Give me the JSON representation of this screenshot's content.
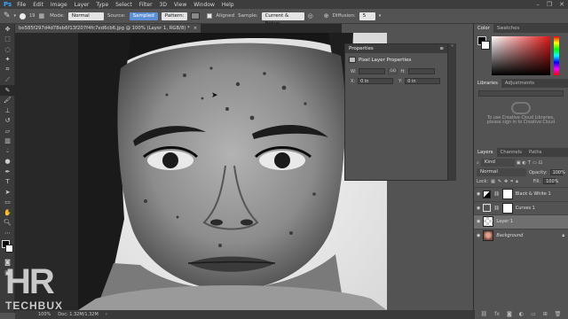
{
  "app": {
    "logo": "Ps"
  },
  "menu": [
    "File",
    "Edit",
    "Image",
    "Layer",
    "Type",
    "Select",
    "Filter",
    "3D",
    "View",
    "Window",
    "Help"
  ],
  "options": {
    "brush_size": "19",
    "mode_label": "Mode:",
    "mode_value": "Normal",
    "source_label": "Source:",
    "source_sampled": "Sampled",
    "source_pattern": "Pattern:",
    "aligned_label": "Aligned",
    "sample_label": "Sample:",
    "sample_value": "Current & Below",
    "diffusion_label": "Diffusion:",
    "diffusion_value": "5"
  },
  "document": {
    "tab_title": "be585f297d4d78eb6f13f207f4fc7ed6cb6.jpg @ 100% (Layer 1, RGB/8) *",
    "zoom": "100%",
    "doc_info": "Doc: 1.32M/1.32M"
  },
  "properties": {
    "title": "Properties",
    "subtitle": "Pixel Layer Properties",
    "w_label": "W:",
    "h_label": "H:",
    "x_label": "X:",
    "y_label": "Y:",
    "x_value": "0 in",
    "y_value": "0 in",
    "link": "GO"
  },
  "color_panel": {
    "tabs": [
      "Color",
      "Swatches"
    ]
  },
  "libraries": {
    "tabs": [
      "Libraries",
      "Adjustments"
    ],
    "message_1": "To use Creative Cloud Libraries,",
    "message_2": "please sign in to Creative Cloud"
  },
  "layers_panel": {
    "tabs": [
      "Layers",
      "Channels",
      "Paths"
    ],
    "kind_label": "Kind",
    "blend_mode": "Normal",
    "opacity_label": "Opacity:",
    "opacity_value": "100%",
    "lock_label": "Lock:",
    "fill_label": "Fill:",
    "fill_value": "100%",
    "layers": [
      {
        "name": "Black & White 1"
      },
      {
        "name": "Curves 1"
      },
      {
        "name": "Layer 1"
      },
      {
        "name": "Background"
      }
    ]
  },
  "watermark": {
    "text_big": "HR",
    "text_small": "TECHBUX"
  },
  "colors": {
    "accent": "#31a8ff",
    "watermark": "#d7d7d7"
  }
}
